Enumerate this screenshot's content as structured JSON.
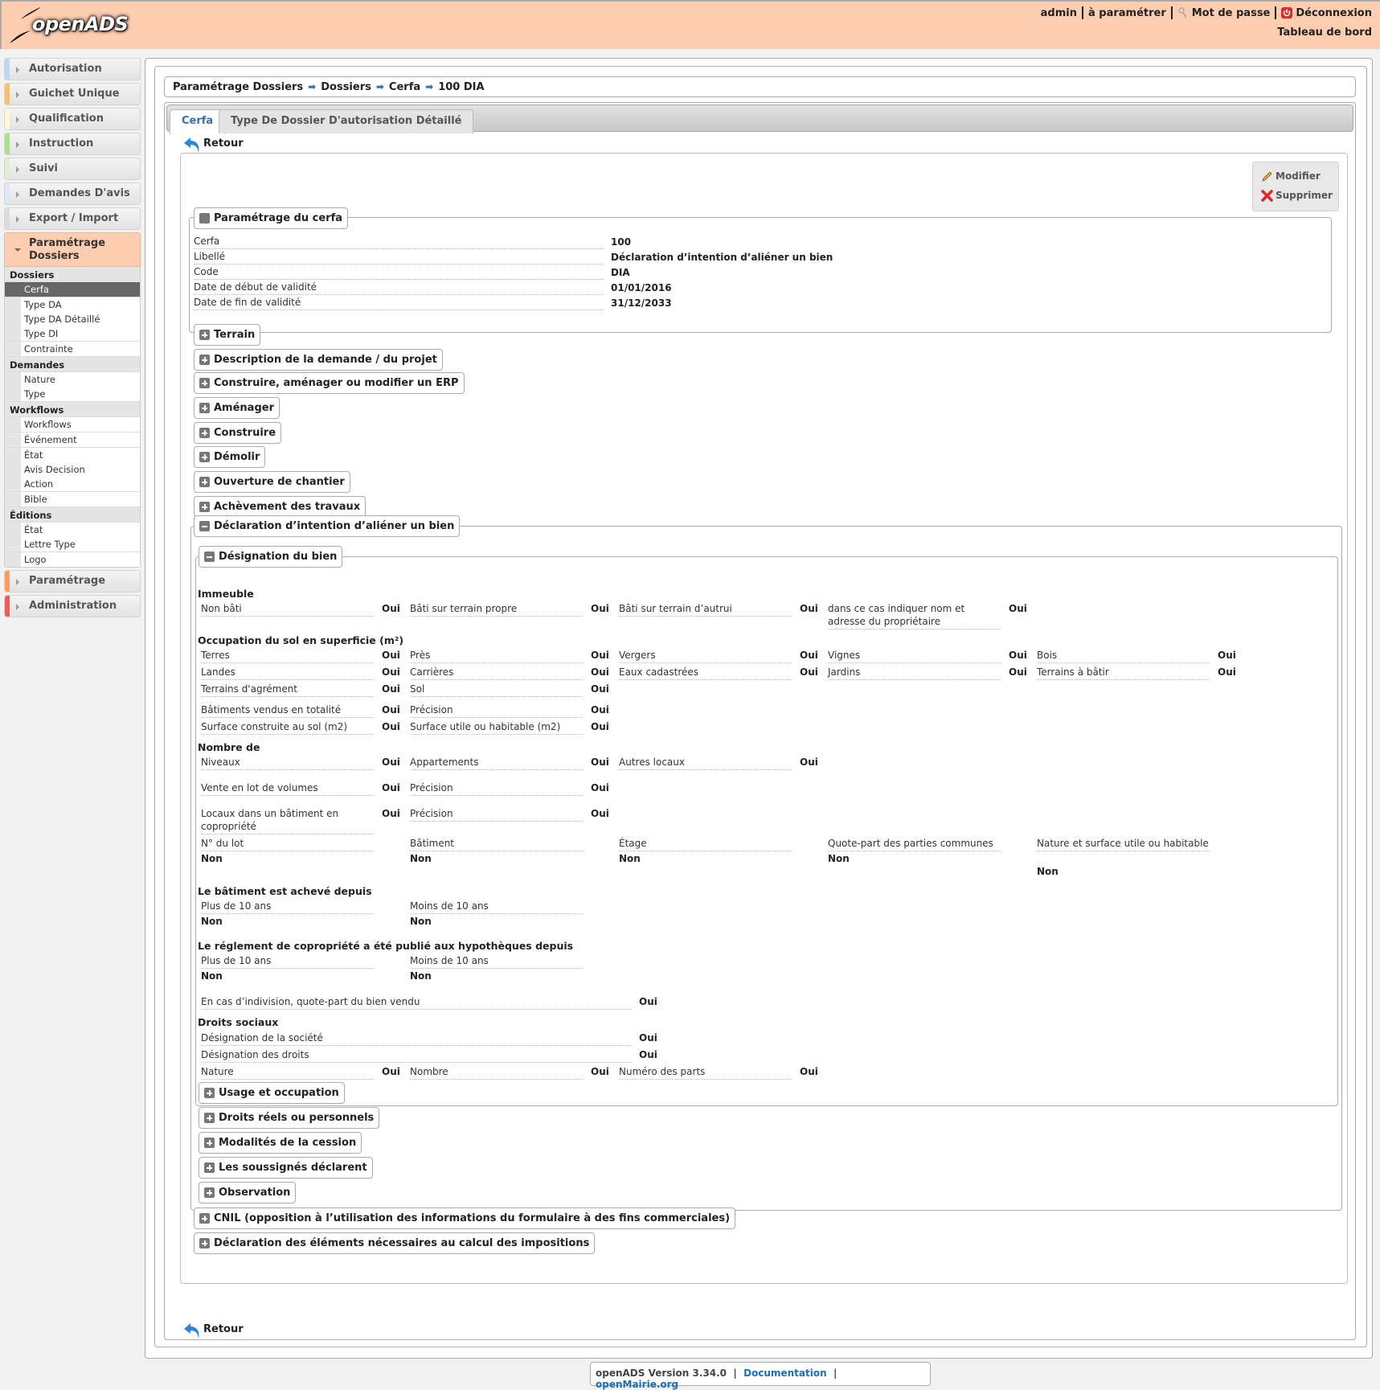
{
  "header": {
    "logo_text": "openADS",
    "user": "admin",
    "collectivite": "à paramétrer",
    "password_link": "Mot de passe",
    "logout_link": "Déconnexion",
    "dashboard_link": "Tableau de bord"
  },
  "sidebar": {
    "categories": [
      {
        "label": "Autorisation",
        "color": "#bcd6f5"
      },
      {
        "label": "Guichet Unique",
        "color": "#f9c06e"
      },
      {
        "label": "Qualification",
        "color": "#fdf9d8"
      },
      {
        "label": "Instruction",
        "color": "#a9e08a"
      },
      {
        "label": "Suivi",
        "color": "#e3ecd1"
      },
      {
        "label": "Demandes D'avis",
        "color": "#d9e8fa"
      },
      {
        "label": "Export / Import",
        "color": "#dcdcdc"
      },
      {
        "label": "Paramétrage Dossiers",
        "color": "#ffcdb0"
      },
      {
        "label": "Paramétrage",
        "color": "#ff9d5c"
      },
      {
        "label": "Administration",
        "color": "#f25a5a"
      }
    ],
    "submenu": {
      "dossiers_title": "Dossiers",
      "dossiers": [
        "Cerfa",
        "Type DA",
        "Type DA Détaillé",
        "Type DI",
        "Contrainte"
      ],
      "demandes_title": "Demandes",
      "demandes": [
        "Nature",
        "Type"
      ],
      "workflows_title": "Workflows",
      "workflows": [
        "Workflows",
        "Événement",
        "État",
        "Avis Decision",
        "Action",
        "Bible"
      ],
      "editions_title": "Éditions",
      "editions": [
        "État",
        "Lettre Type",
        "Logo"
      ]
    }
  },
  "breadcrumb": [
    "Paramétrage Dossiers",
    "Dossiers",
    "Cerfa",
    "100 DIA"
  ],
  "tabs": [
    {
      "label": "Cerfa",
      "active": true
    },
    {
      "label": "Type De Dossier D'autorisation Détaillé",
      "active": false
    }
  ],
  "retour_label": "Retour",
  "actions": {
    "modify": "Modifier",
    "delete": "Supprimer"
  },
  "param_cerfa": {
    "legend": "Paramétrage du cerfa",
    "fields": [
      {
        "label": "Cerfa",
        "value": "100"
      },
      {
        "label": "Libellé",
        "value": "Déclaration d’intention d’aliéner un bien"
      },
      {
        "label": "Code",
        "value": "DIA"
      },
      {
        "label": "Date de début de validité",
        "value": "01/01/2016"
      },
      {
        "label": "Date de fin de validité",
        "value": "31/12/2033"
      }
    ]
  },
  "collapsed_sections": [
    "Terrain",
    "Description de la demande / du projet",
    "Construire, aménager ou modifier un ERP",
    "Aménager",
    "Construire",
    "Démolir",
    "Ouverture de chantier",
    "Achèvement des travaux"
  ],
  "dia": {
    "legend": "Déclaration d’intention d’aliéner un bien",
    "designation": {
      "legend": "Désignation du bien",
      "immeuble_title": "Immeuble",
      "immeuble": [
        {
          "label": "Non bâti",
          "value": "Oui"
        },
        {
          "label": "Bâti sur terrain propre",
          "value": "Oui"
        },
        {
          "label": "Bâti sur terrain d’autrui",
          "value": "Oui"
        },
        {
          "label": "dans ce cas indiquer nom et adresse du propriétaire",
          "value": "Oui"
        }
      ],
      "occupation_title": "Occupation du sol en superficie (m²)",
      "occupation": [
        {
          "label": "Terres",
          "value": "Oui"
        },
        {
          "label": "Près",
          "value": "Oui"
        },
        {
          "label": "Vergers",
          "value": "Oui"
        },
        {
          "label": "Vignes",
          "value": "Oui"
        },
        {
          "label": "Bois",
          "value": "Oui"
        },
        {
          "label": "Landes",
          "value": "Oui"
        },
        {
          "label": "Carrières",
          "value": "Oui"
        },
        {
          "label": "Eaux cadastrées",
          "value": "Oui"
        },
        {
          "label": "Jardins",
          "value": "Oui"
        },
        {
          "label": "Terrains à bâtir",
          "value": "Oui"
        },
        {
          "label": "Terrains d'agrément",
          "value": "Oui"
        },
        {
          "label": "Sol",
          "value": "Oui"
        }
      ],
      "batiments": [
        {
          "label": "Bâtiments vendus en totalité",
          "value": "Oui"
        },
        {
          "label": "Précision",
          "value": "Oui"
        },
        {
          "label": "Surface construite au sol (m2)",
          "value": "Oui"
        },
        {
          "label": "Surface utile ou habitable (m2)",
          "value": "Oui"
        }
      ],
      "nombre_title": "Nombre de",
      "nombre": [
        {
          "label": "Niveaux",
          "value": "Oui"
        },
        {
          "label": "Appartements",
          "value": "Oui"
        },
        {
          "label": "Autres locaux",
          "value": "Oui"
        }
      ],
      "vente_lot": [
        {
          "label": "Vente en lot de volumes",
          "value": "Oui"
        },
        {
          "label": "Précision",
          "value": "Oui"
        }
      ],
      "locaux_copro": [
        {
          "label": "Locaux dans un bâtiment en copropriété",
          "value": "Oui"
        },
        {
          "label": "Précision",
          "value": "Oui"
        }
      ],
      "lot": [
        {
          "label": "N° du lot",
          "value": "Non"
        },
        {
          "label": "Bâtiment",
          "value": "Non"
        },
        {
          "label": "Étage",
          "value": "Non"
        },
        {
          "label": "Quote-part des parties communes",
          "value": "Non"
        },
        {
          "label": "Nature et surface utile ou habitable",
          "value": "Non"
        }
      ],
      "acheve_title": "Le bâtiment est achevé depuis",
      "acheve": [
        {
          "label": "Plus de 10 ans",
          "value": "Non"
        },
        {
          "label": "Moins de 10 ans",
          "value": "Non"
        }
      ],
      "reglement_title": "Le réglement de copropriété a été publié aux hypothèques depuis",
      "reglement": [
        {
          "label": "Plus de 10 ans",
          "value": "Non"
        },
        {
          "label": "Moins de 10 ans",
          "value": "Non"
        }
      ],
      "indivision": {
        "label": "En cas d’indivision, quote-part du bien vendu",
        "value": "Oui"
      },
      "droits_title": "Droits sociaux",
      "droits_wide": [
        {
          "label": "Désignation de la société",
          "value": "Oui"
        },
        {
          "label": "Désignation des droits",
          "value": "Oui"
        }
      ],
      "droits": [
        {
          "label": "Nature",
          "value": "Oui"
        },
        {
          "label": "Nombre",
          "value": "Oui"
        },
        {
          "label": "Numéro des parts",
          "value": "Oui"
        }
      ]
    },
    "sub_collapsed": [
      "Usage et occupation",
      "Droits réels ou personnels",
      "Modalités de la cession",
      "Les soussignés déclarent",
      "Observation"
    ]
  },
  "bottom_sections": [
    "CNIL (opposition à l’utilisation des informations du formulaire à des fins commerciales)",
    "Déclaration des éléments nécessaires au calcul des impositions"
  ],
  "footer": {
    "version": "openADS Version 3.34.0",
    "documentation": "Documentation",
    "site": "openMairie.org"
  }
}
